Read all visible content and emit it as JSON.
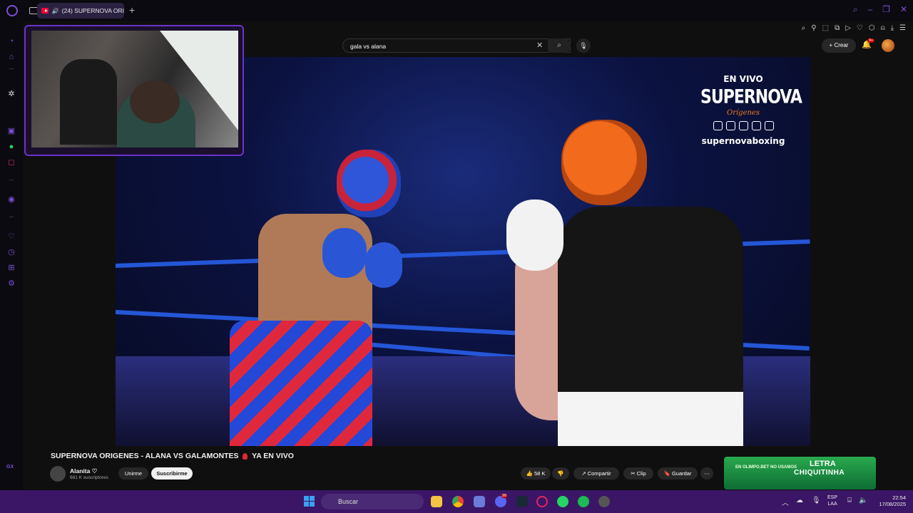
{
  "browser": {
    "tab_label": "(24) SUPERNOVA ORI",
    "new_tab_icon": "plus-icon",
    "sidebar_label": "GX"
  },
  "youtube": {
    "search_value": "gala vs alana",
    "create_label": "Crear",
    "notifications_badge": "9+"
  },
  "video": {
    "overlay_live": "EN VIVO",
    "overlay_brand": "SUPERNOVA",
    "overlay_sub": "Orígenes",
    "overlay_handle": "supernovaboxing"
  },
  "info": {
    "title_part1": "SUPERNOVA ORIGENES - ALANA VS GALAMONTES",
    "title_part2": "YA EN VIVO",
    "channel_name": "Alanita ♡",
    "channel_subs": "681 K suscriptores",
    "join_label": "Unirme",
    "subscribe_label": "Suscribirme",
    "likes": "58 K",
    "share_label": "Compartir",
    "clip_label": "Clip",
    "save_label": "Guardar",
    "ad_small": "EN OLIMPO.BET NO USAMOS",
    "ad_big1": "LETRA",
    "ad_big2": "CHIQUITINHA"
  },
  "taskbar": {
    "search_placeholder": "Buscar",
    "lang_line1": "ESP",
    "lang_line2": "LAA",
    "time": "22:54",
    "date": "17/08/2025",
    "discord_badge": "99"
  },
  "colors": {
    "accent": "#7b4fd6",
    "taskbar": "#3b1666",
    "youtube_red": "#ff0033"
  }
}
